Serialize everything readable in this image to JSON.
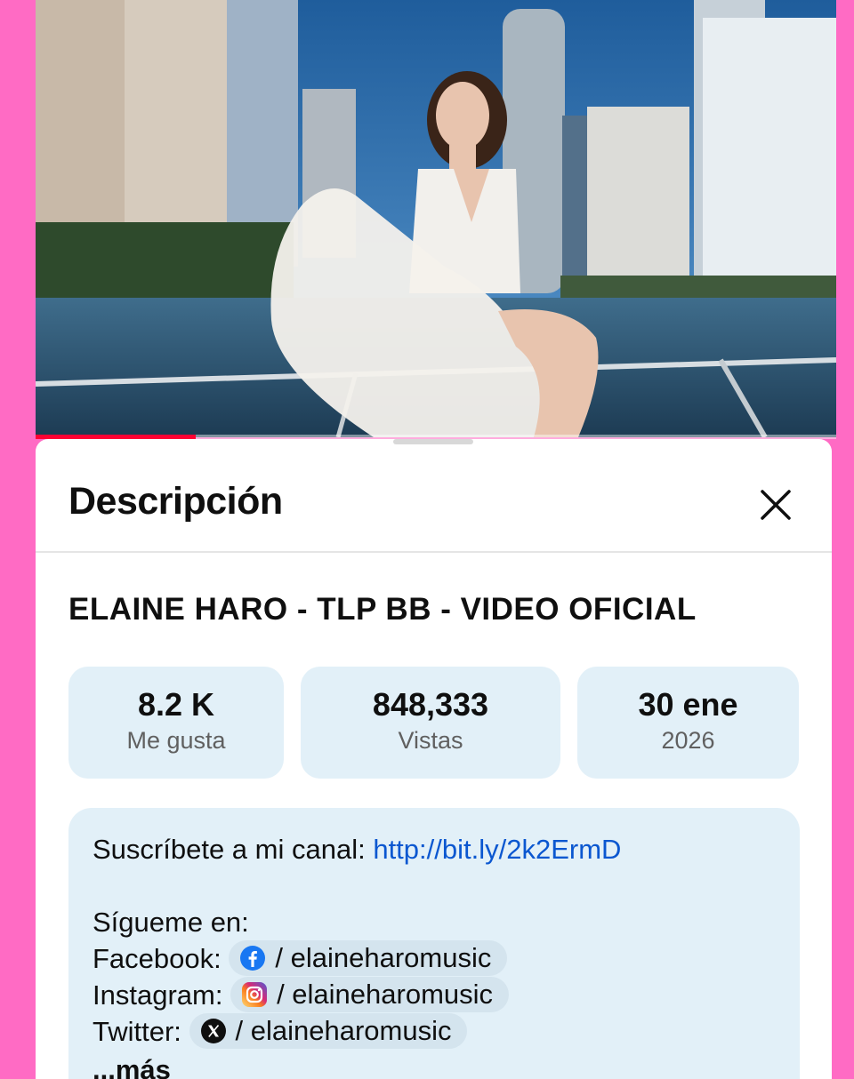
{
  "sheet": {
    "title": "Descripción",
    "close_icon": "close-icon"
  },
  "video": {
    "title": "ELAINE HARO - TLP BB - VIDEO OFICIAL",
    "progress": 0.2
  },
  "stats": [
    {
      "value": "8.2 K",
      "label": "Me gusta"
    },
    {
      "value": "848,333",
      "label": "Vistas"
    },
    {
      "value": "30 ene",
      "label": "2026"
    }
  ],
  "description": {
    "subscribe_text": "Suscríbete a mi canal: ",
    "subscribe_link": "http://bit.ly/2k2ErmD",
    "follow_text": "Sígueme en:",
    "socials": [
      {
        "label": "Facebook: ",
        "handle": "/ elaineharomusic",
        "icon": "facebook-icon",
        "color": "#1877f2"
      },
      {
        "label": "Instagram: ",
        "handle": "/ elaineharomusic",
        "icon": "instagram-icon",
        "color": "#e1306c"
      },
      {
        "label": "Twitter: ",
        "handle": "/ elaineharomusic",
        "icon": "x-icon",
        "color": "#0f0f0f"
      }
    ],
    "more": "...más"
  },
  "colors": {
    "background": "#ff6bc4",
    "card": "#e2f0f8",
    "link": "#0b57d0",
    "progress": "#ff0033"
  }
}
